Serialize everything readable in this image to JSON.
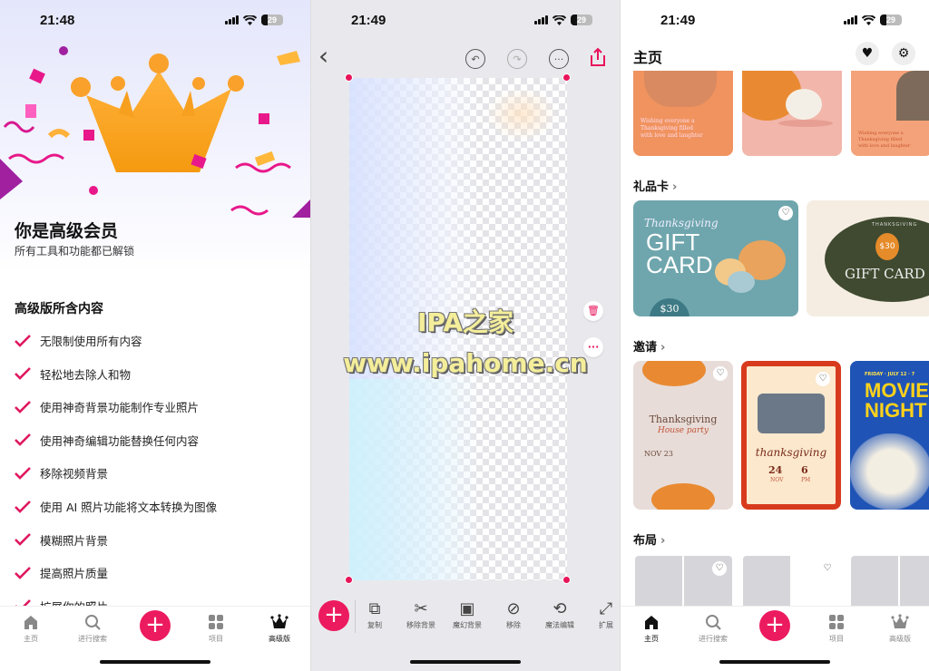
{
  "status_bars": [
    {
      "time": "21:48",
      "battery": "29"
    },
    {
      "time": "21:49",
      "battery": "29"
    },
    {
      "time": "21:49",
      "battery": "29"
    }
  ],
  "premium": {
    "title": "你是高级会员",
    "subtitle": "所有工具和功能都已解锁",
    "section_title": "高级版所含内容",
    "features": [
      "无限制使用所有内容",
      "轻松地去除人和物",
      "使用神奇背景功能制作专业照片",
      "使用神奇编辑功能替换任何内容",
      "移除视频背景",
      "使用 AI 照片功能将文本转换为图像",
      "模糊照片背景",
      "提高照片质量",
      "扩展你的照片"
    ]
  },
  "tabbar": {
    "items": [
      {
        "label": "主页",
        "icon": "home-icon"
      },
      {
        "label": "进行搜索",
        "icon": "search-icon"
      },
      {
        "label": "",
        "icon": "plus-icon"
      },
      {
        "label": "项目",
        "icon": "grid-icon"
      },
      {
        "label": "高级版",
        "icon": "crown-icon"
      }
    ],
    "active_panel1": "高级版",
    "active_panel3": "主页"
  },
  "editor": {
    "back": "‹",
    "watermark_line1": "IPA之家",
    "watermark_line2": "www.ipahome.cn",
    "tools": [
      {
        "label": "复制",
        "icon": "duplicate-icon"
      },
      {
        "label": "移除背景",
        "icon": "scissors-icon"
      },
      {
        "label": "魔幻背景",
        "icon": "image-sparkle-icon"
      },
      {
        "label": "移除",
        "icon": "bandage-icon"
      },
      {
        "label": "魔法编辑",
        "icon": "magic-edit-icon"
      },
      {
        "label": "扩展",
        "icon": "expand-icon"
      }
    ]
  },
  "home": {
    "title": "主页",
    "top_cards": [
      {
        "text": "Wishing everyone a Thanksgiving filled with love and laughter"
      },
      {
        "text": ""
      },
      {
        "text": "Wishing everyone a Thanksgiving filled with love and laughter"
      }
    ],
    "sections": [
      {
        "title": "礼品卡",
        "cards": [
          {
            "line1": "Thanksgiving",
            "line2": "GIFT",
            "line3": "CARD",
            "price": "$30"
          },
          {
            "line1": "THANKSGIVING",
            "line2": "GIFT CARD",
            "price": "$30"
          }
        ]
      },
      {
        "title": "邀请",
        "cards": [
          {
            "line1": "Thanksgiving",
            "line2": "House party",
            "date": "NOV 23"
          },
          {
            "line1": "thanksgiving",
            "day": "24",
            "month": "NOV",
            "time": "6",
            "ampm": "PM"
          },
          {
            "line1": "FRIDAY · JULY 12 · 7",
            "line2": "MOVIE",
            "line3": "NIGHT"
          }
        ]
      },
      {
        "title": "布局",
        "cards": [
          {},
          {},
          {}
        ]
      }
    ],
    "chevron": "›"
  },
  "colors": {
    "accent": "#ec1a5f",
    "orange_card": "#f0935f",
    "gift_teal": "#6fa6ad",
    "movie_blue": "#1f54b6"
  }
}
